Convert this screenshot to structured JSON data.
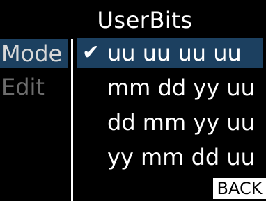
{
  "header": {
    "title": "UserBits"
  },
  "sidebar": {
    "items": [
      {
        "label": "Mode",
        "selected": true
      },
      {
        "label": "Edit",
        "selected": false
      }
    ]
  },
  "options": {
    "items": [
      {
        "label": "uu uu uu uu",
        "checked": true,
        "check_icon": "✔"
      },
      {
        "label": "mm dd yy uu",
        "checked": false
      },
      {
        "label": "dd mm yy uu",
        "checked": false
      },
      {
        "label": "yy mm dd uu",
        "checked": false
      }
    ]
  },
  "footer": {
    "back_label": "BACK"
  },
  "colors": {
    "background": "#000000",
    "highlight": "#1c4060",
    "text": "#ffffff",
    "dim_text": "#6c6c6c"
  }
}
